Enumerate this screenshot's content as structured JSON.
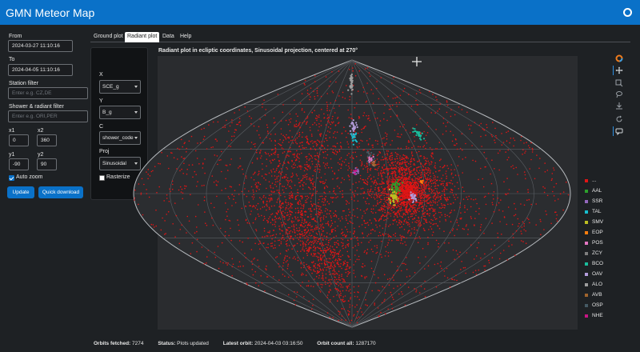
{
  "header": {
    "title": "GMN Meteor Map",
    "settings_icon": "settings-icon"
  },
  "filters": {
    "from_label": "From",
    "from_value": "2024-03-27 11:10:16",
    "to_label": "To",
    "to_value": "2024-04-05 11:10:16",
    "station_label": "Station filter",
    "station_placeholder": "Enter e.g. CZ,DE",
    "shower_label": "Shower & radiant filter",
    "shower_placeholder": "Enter e.g. ORI,PER",
    "x1_label": "x1",
    "x1_value": "0",
    "x2_label": "x2",
    "x2_value": "360",
    "y1_label": "y1",
    "y1_value": "-90",
    "y2_label": "y2",
    "y2_value": "90",
    "auto_zoom_label": "Auto zoom",
    "auto_zoom_checked": true,
    "update_label": "Update",
    "quick_download_label": "Quick download"
  },
  "tabs": [
    "Ground plot",
    "Radiant plot",
    "Data",
    "Help"
  ],
  "active_tab": "Radiant plot",
  "controls": {
    "x_label": "X",
    "x_value": "SCE_g",
    "y_label": "Y",
    "y_value": "B_g",
    "c_label": "C",
    "c_value": "shower_code",
    "proj_label": "Proj",
    "proj_value": "Sinusoidal",
    "rasterize_label": "Rasterize",
    "rasterize_checked": false
  },
  "plot": {
    "title": "Radiant plot in ecliptic coordinates, Sinusoidal projection, centered at 270°",
    "background": "#2a2c2f",
    "sporadic_color": "#e01515"
  },
  "legend": [
    {
      "name": "...",
      "color": "#e01515"
    },
    {
      "name": "AAL",
      "color": "#2ca02c"
    },
    {
      "name": "SSR",
      "color": "#9467bd"
    },
    {
      "name": "TAL",
      "color": "#17becf"
    },
    {
      "name": "SMV",
      "color": "#bcbd22"
    },
    {
      "name": "EOP",
      "color": "#ff7f0e"
    },
    {
      "name": "POS",
      "color": "#e377c2"
    },
    {
      "name": "ZCY",
      "color": "#7f7f7f"
    },
    {
      "name": "BCO",
      "color": "#1abc9c"
    },
    {
      "name": "OAV",
      "color": "#b39ddb"
    },
    {
      "name": "ALO",
      "color": "#9e9e9e"
    },
    {
      "name": "AVB",
      "color": "#a0642d"
    },
    {
      "name": "OSP",
      "color": "#455a64"
    },
    {
      "name": "NHE",
      "color": "#c71585"
    }
  ],
  "footer": {
    "orbits_fetched_label": "Orbits fetched:",
    "orbits_fetched_value": "7274",
    "status_label": "Status:",
    "status_value": "Plots updated",
    "latest_orbit_label": "Latest orbit:",
    "latest_orbit_value": "2024-04-03 03:16:50",
    "orbit_count_label": "Orbit count all:",
    "orbit_count_value": "1287170"
  }
}
